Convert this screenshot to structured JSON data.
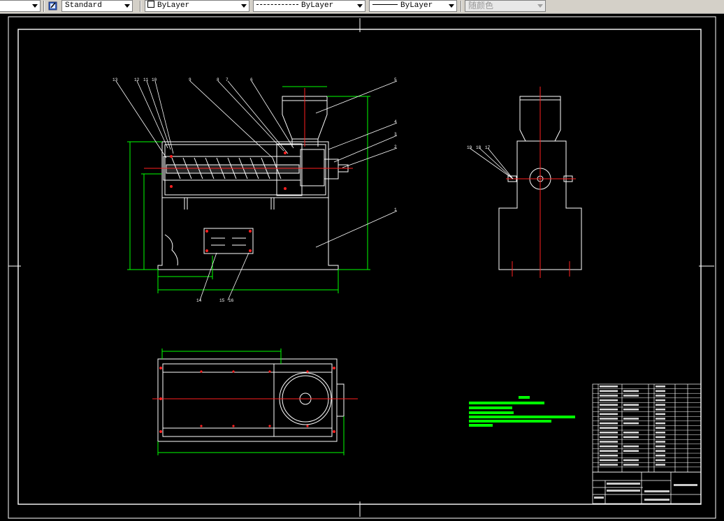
{
  "toolbar": {
    "text_style": "Standard",
    "layer": "ByLayer",
    "linetype": "ByLayer",
    "lineweight": "ByLayer",
    "plot_style": "随颜色"
  },
  "colors": {
    "background": "#000000",
    "geometry": "#ffffff",
    "dimension": "#00ff00",
    "centerline": "#ff0000",
    "toolbar": "#d4d0c8"
  },
  "drawing": {
    "balloons": [
      "13",
      "12",
      "11",
      "10",
      "9",
      "8",
      "7",
      "6",
      "5",
      "4",
      "3",
      "2",
      "1",
      "14",
      "15",
      "16",
      "19",
      "18",
      "17"
    ]
  }
}
